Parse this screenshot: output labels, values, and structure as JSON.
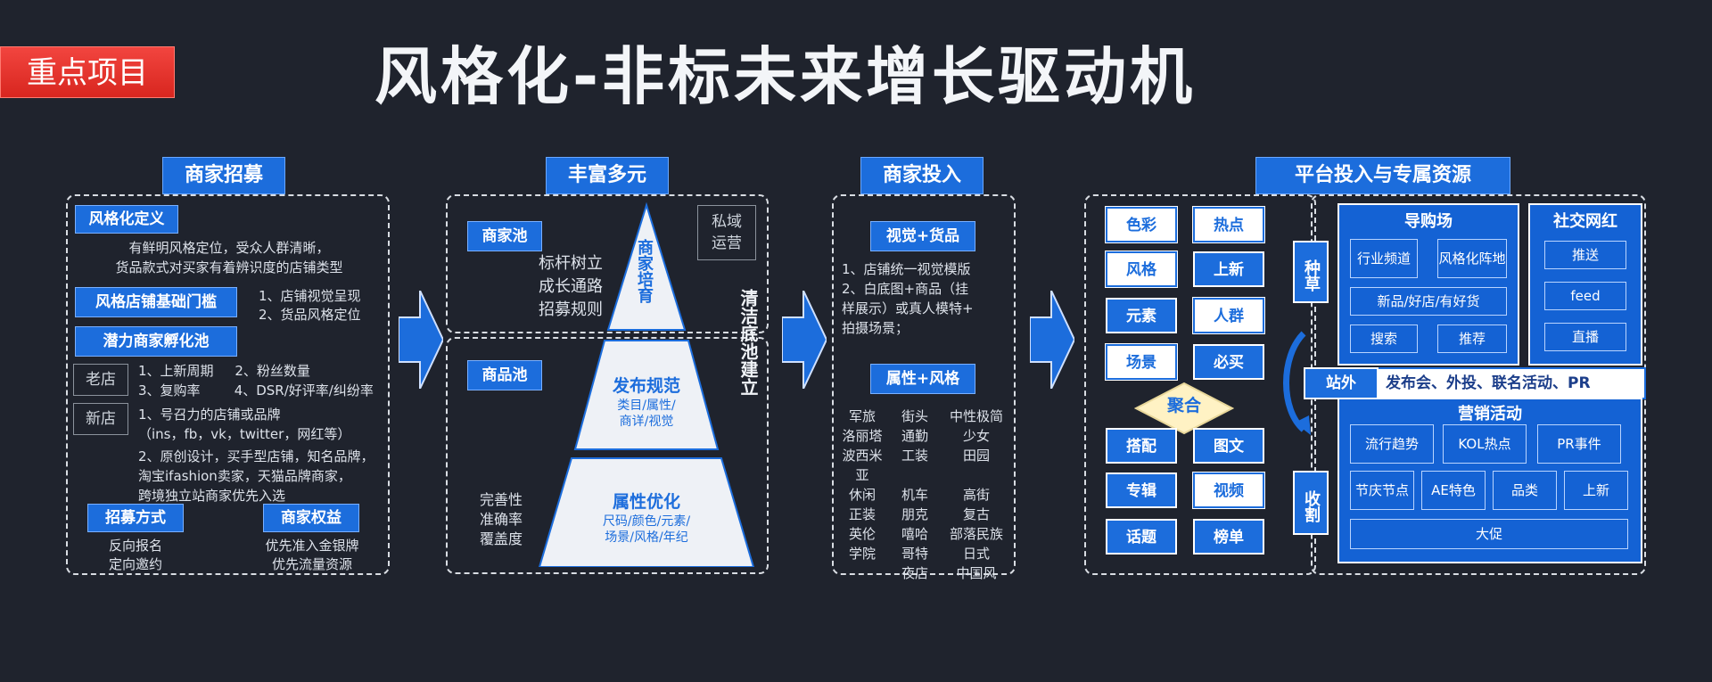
{
  "tag": "重点项目",
  "title": "风格化-非标未来增长驱动机",
  "section1": {
    "header": "商家招募",
    "def_label": "风格化定义",
    "def_text": [
      "有鲜明风格定位，受众人群清晰，",
      "货品款式对买家有着辨识度的店铺类型"
    ],
    "threshold_label": "风格店铺基础门槛",
    "threshold_items": [
      "1、店铺视觉呈现",
      "2、货品风格定位"
    ],
    "pool_label": "潜力商家孵化池",
    "old_store": "老店",
    "old_items": [
      "1、上新周期     2、粉丝数量",
      "3、复购率        4、DSR/好评率/纠纷率"
    ],
    "new_store": "新店",
    "new_items": [
      "1、号召力的店铺或品牌",
      "（ins，fb，vk，twitter，网红等）",
      "2、原创设计，买手型店铺，知名品牌，",
      "淘宝ifashion卖家，天猫品牌商家，",
      "跨境独立站商家优先入选"
    ],
    "recruit_label": "招募方式",
    "recruit_items": [
      "反向报名",
      "定向邀约"
    ],
    "rights_label": "商家权益",
    "rights_items": [
      "优先准入金银牌",
      "优先流量资源"
    ]
  },
  "section2": {
    "header": "丰富多元",
    "merchant_pool": "商家池",
    "merchant_items": [
      "标杆树立",
      "成长通路",
      "招募规则"
    ],
    "private_domain": "私域运营",
    "pyramid_top": "商家培育",
    "goods_pool": "商品池",
    "publish_title": "发布规范",
    "publish_sub": [
      "类目/属性/",
      "商详/视觉"
    ],
    "attr_title": "属性优化",
    "attr_sub": [
      "尺码/颜色/元素/",
      "场景/风格/年纪"
    ],
    "quality_items": [
      "完善性",
      "准确率",
      "覆盖度"
    ],
    "side_text": "清洁底池建立"
  },
  "section3": {
    "header": "商家投入",
    "visual_label": "视觉+货品",
    "visual_items": [
      "1、店铺统一视觉模版",
      "2、白底图+商品（挂",
      "样展示）或真人模特+",
      "拍摄场景；"
    ],
    "attr_style_label": "属性+风格",
    "styles": [
      [
        "军旅",
        "街头",
        "中性极简"
      ],
      [
        "洛丽塔",
        "通勤",
        "少女"
      ],
      [
        "波西米亚",
        "工装",
        "田园"
      ],
      [
        "休闲",
        "机车",
        "高街"
      ],
      [
        "正装",
        "朋克",
        "复古"
      ],
      [
        "英伦",
        "嘻哈",
        "部落民族"
      ],
      [
        "学院",
        "哥特",
        "日式"
      ],
      [
        "",
        "夜店",
        "中国风"
      ]
    ]
  },
  "section4": {
    "header": "平台投入与专属资源",
    "left_col": [
      "色彩",
      "风格",
      "元素",
      "场景"
    ],
    "right_col": [
      "热点",
      "上新",
      "人群",
      "必买"
    ],
    "aggregate": "聚合",
    "left_col2": [
      "搭配",
      "专辑",
      "话题"
    ],
    "right_col2": [
      "图文",
      "视频",
      "榜单"
    ],
    "seed": "种草",
    "harvest": "收割",
    "offsite": "站外",
    "offsite_text": "发布会、外投、联名活动、PR",
    "guide_title": "导购场",
    "guide_cells": [
      "行业频道",
      "风格化阵地",
      "新品/好店/有好货",
      "搜索",
      "推荐"
    ],
    "social_title": "社交网红",
    "social_cells": [
      "推送",
      "feed",
      "直播"
    ],
    "marketing_title": "营销活动",
    "marketing_row1": [
      "流行趋势",
      "KOL热点",
      "PR事件"
    ],
    "marketing_row2": [
      "节庆节点",
      "AE特色",
      "品类",
      "上新"
    ],
    "promo": "大促"
  },
  "colors": {
    "background": "#1f232d",
    "accent_blue": "#1c6ddc",
    "tag_red": "#e0312a"
  }
}
